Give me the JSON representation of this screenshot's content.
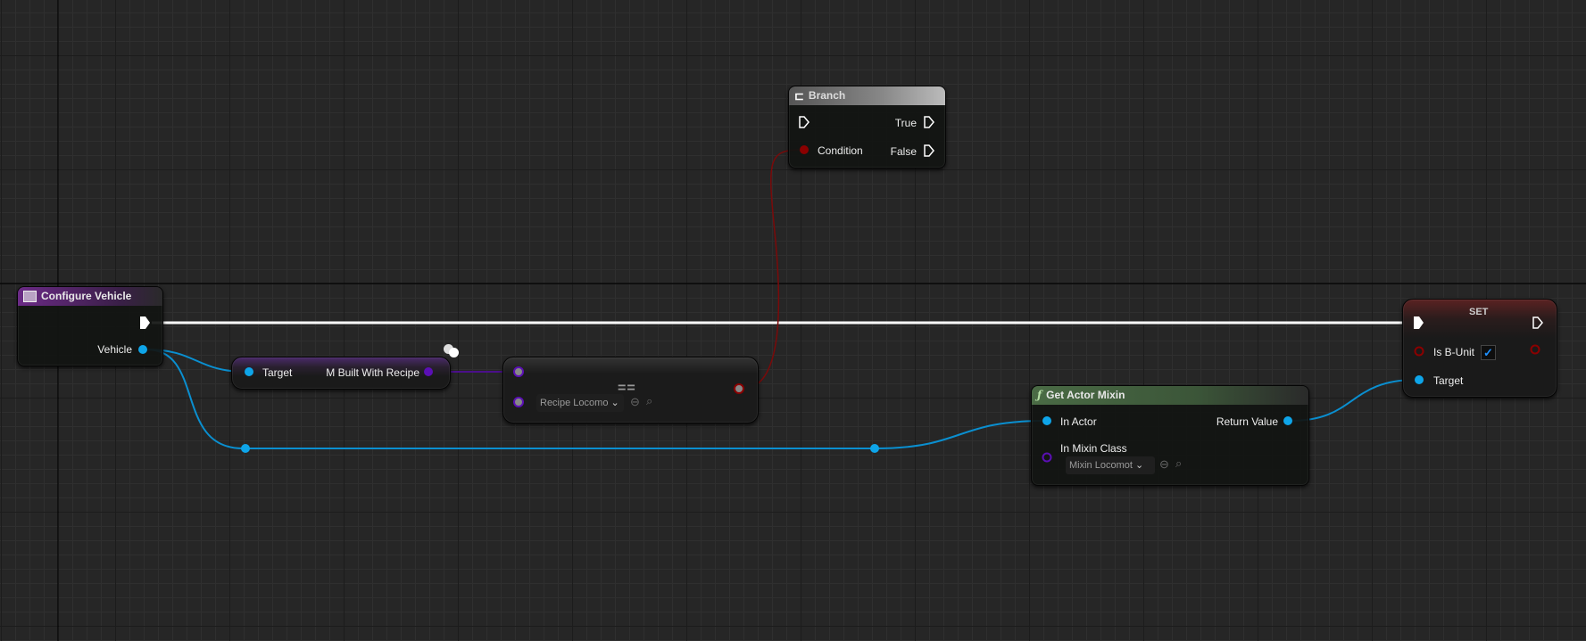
{
  "nodes": {
    "configure_vehicle": {
      "title": "Configure Vehicle",
      "pin_vehicle": "Vehicle"
    },
    "m_built": {
      "target": "Target",
      "output": "M Built With Recipe"
    },
    "equals": {
      "symbol": "==",
      "dropdown": "Recipe Locomo"
    },
    "branch": {
      "title": "Branch",
      "true": "True",
      "condition": "Condition",
      "false": "False"
    },
    "get_actor_mixin": {
      "title": "Get Actor Mixin",
      "in_actor": "In Actor",
      "return_value": "Return Value",
      "in_mixin_class": "In Mixin Class",
      "dropdown": "Mixin Locomot"
    },
    "set": {
      "title": "SET",
      "is_b_unit": "Is B-Unit",
      "is_b_unit_checked": true,
      "target": "Target"
    }
  },
  "colors": {
    "exec": "#ffffff",
    "object": "#0ea5e9",
    "class": "#5b0fb5",
    "bool": "#8b0000",
    "event_header": "#6b2a86",
    "function_header": "#4a6b45",
    "set_header": "#5a2222"
  }
}
